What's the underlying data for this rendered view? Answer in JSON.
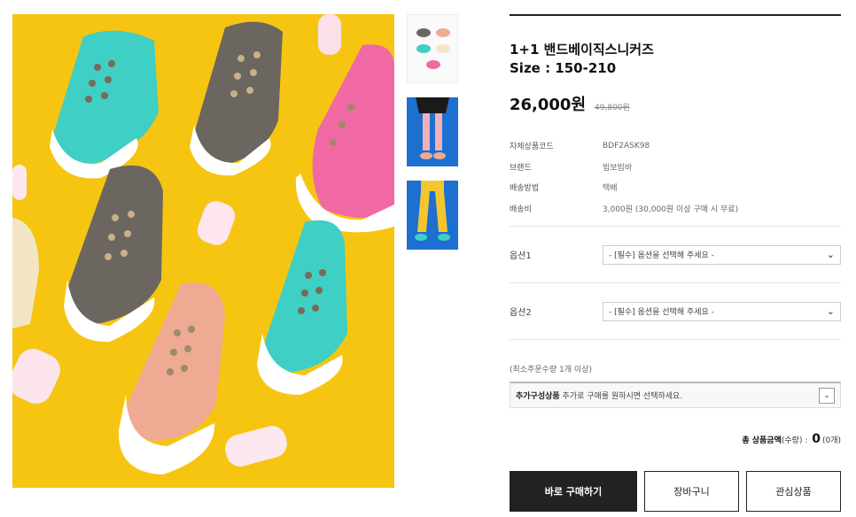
{
  "product": {
    "title": "1+1 밴드베이직스니커즈",
    "size": "Size : 150-210",
    "price": "26,000원",
    "original_price": "49,800원"
  },
  "specs": [
    {
      "label": "자체상품코드",
      "value": "BDF2ASK98"
    },
    {
      "label": "브랜드",
      "value": "빔보빔바"
    },
    {
      "label": "배송방법",
      "value": "택배"
    },
    {
      "label": "배송비",
      "value": "3,000원 (30,000원 이상 구매 시 무료)"
    }
  ],
  "options": [
    {
      "label": "옵션1",
      "placeholder": "- [필수] 옵션을 선택해 주세요 -"
    },
    {
      "label": "옵션2",
      "placeholder": "- [필수] 옵션을 선택해 주세요 -"
    }
  ],
  "min_order": "(최소주문수량 1개 이상)",
  "addon": {
    "bold": "추가구성상품",
    "text": " 추가로 구매를 원하시면 선택하세요."
  },
  "total": {
    "label": "총 상품금액",
    "qty_label": "(수량) : ",
    "amount": "0",
    "count": "(0개)"
  },
  "buttons": {
    "buy": "바로 구매하기",
    "cart": "장바구니",
    "wish": "관심상품"
  },
  "colors": {
    "background_yellow": "#f6c512",
    "mint": "#3fcfc4",
    "gray": "#6b665f",
    "pink": "#f069a4",
    "peach": "#eeaa92",
    "dark_button": "#222222"
  }
}
